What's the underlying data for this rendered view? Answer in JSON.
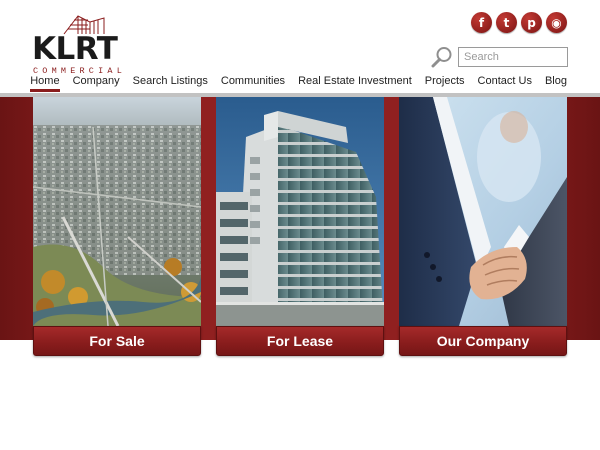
{
  "brand": {
    "name": "KLRT",
    "sub": "COMMERCIAL",
    "color": "#8a1c1c"
  },
  "social": [
    {
      "icon": "facebook-icon",
      "glyph": "f"
    },
    {
      "icon": "twitter-icon",
      "glyph": "t"
    },
    {
      "icon": "pinterest-icon",
      "glyph": "p"
    },
    {
      "icon": "rss-icon",
      "glyph": "◉"
    }
  ],
  "search": {
    "placeholder": "Search",
    "value": ""
  },
  "nav": {
    "items": [
      {
        "label": "Home",
        "active": true
      },
      {
        "label": "Company"
      },
      {
        "label": "Search Listings"
      },
      {
        "label": "Communities"
      },
      {
        "label": "Real Estate Investment"
      },
      {
        "label": "Projects"
      },
      {
        "label": "Contact Us"
      },
      {
        "label": "Blog"
      }
    ]
  },
  "panels": [
    {
      "label": "For Sale",
      "image": "aerial-city-photo"
    },
    {
      "label": "For Lease",
      "image": "office-building-photo"
    },
    {
      "label": "Our Company",
      "image": "handshake-photo"
    }
  ]
}
